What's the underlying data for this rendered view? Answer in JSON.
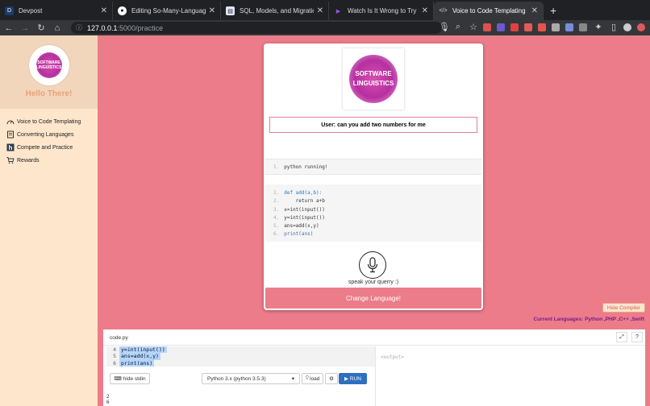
{
  "browser": {
    "tabs": [
      {
        "label": "Devpost",
        "favicon": "D",
        "color": "#1a3b6e",
        "active": false
      },
      {
        "label": "Editing So-Many-Languages/R",
        "favicon": "gh",
        "color": "#333333",
        "active": false
      },
      {
        "label": "SQL, Models, and Migrations |",
        "favicon": "s",
        "color": "#4a5a8a",
        "active": false
      },
      {
        "label": "Watch Is It Wrong to Try to Pic",
        "favicon": "▶",
        "color": "#8a2be2",
        "active": false
      },
      {
        "label": "Voice to Code Templating",
        "favicon": "</>",
        "color": "#555555",
        "active": true
      }
    ],
    "url_host": "127.0.0.1",
    "url_path": ":5000/practice"
  },
  "sidebar": {
    "logo_text": [
      "SOFTWARE",
      "LINGUISTICS"
    ],
    "greeting": "Hello There!",
    "items": [
      {
        "label": "Voice to Code Templating",
        "icon": "speedometer-icon"
      },
      {
        "label": "Converting Languages",
        "icon": "notebook-icon"
      },
      {
        "label": "Compete and Practice",
        "icon": "hackerrank-icon"
      },
      {
        "label": "Rewards",
        "icon": "cart-icon"
      }
    ]
  },
  "card": {
    "logo_text": [
      "SOFTWARE",
      "LINGUISTICS"
    ],
    "query": "User: can you add two numbers for me",
    "run_line": {
      "num": "1.",
      "text": "python running!"
    },
    "code_lines": [
      {
        "num": "1.",
        "text": "def add(a,b):"
      },
      {
        "num": "2.",
        "text": "    return a+b"
      },
      {
        "num": "3.",
        "text": "x=int(input())"
      },
      {
        "num": "4.",
        "text": "y=int(input())"
      },
      {
        "num": "5.",
        "text": "ans=add(x,y)"
      },
      {
        "num": "6.",
        "text": "print(ans)"
      }
    ],
    "speak_label": "speak your querry :)",
    "change_button": "Change Language!"
  },
  "hide_compiler_label": "Hide Compiler",
  "current_languages": "Current Languages: Python ,PHP ,C++ ,Swift",
  "compiler": {
    "file_tab": "code.py",
    "expand_label": "⤢",
    "help_label": "?",
    "editor_lines": [
      {
        "num": "4",
        "text": "y=int(input())"
      },
      {
        "num": "5",
        "text": "ans=add(x,y)"
      },
      {
        "num": "6",
        "text": "print(ans)"
      }
    ],
    "output_placeholder": "<output>",
    "hide_stdin": "hide stdin",
    "language_select": "Python 3.x (python 3.5.3)",
    "load_label": "load",
    "settings_label": "⚙",
    "run_label": "▶ RUN",
    "stdin_lines": [
      "2",
      "6"
    ]
  },
  "colors": {
    "accent": "#ec7c8a",
    "sidebar": "#fde6cc",
    "run": "#2e6fc0"
  }
}
